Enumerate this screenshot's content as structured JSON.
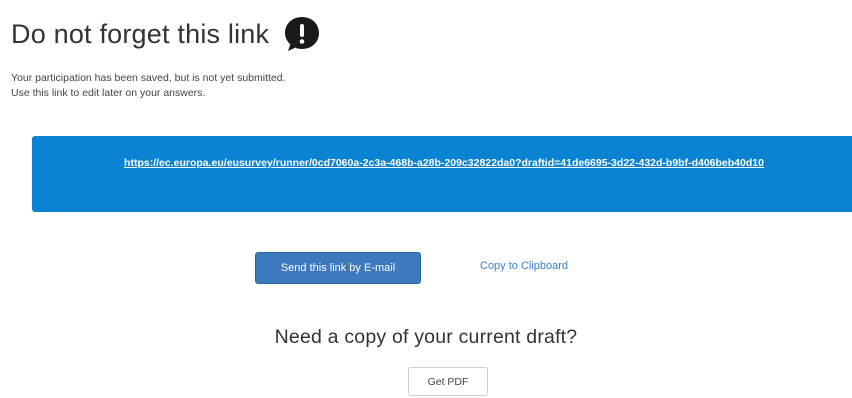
{
  "header": {
    "title": "Do not forget this link",
    "icon": "speech-bubble-exclamation-icon"
  },
  "message": {
    "line1": "Your participation has been saved, but is not yet submitted.",
    "line2": "Use this link to edit later on your answers."
  },
  "link_box": {
    "url": "https://ec.europa.eu/eusurvey/runner/0cd7060a-2c3a-468b-a28b-209c32822da0?draftid=41de6695-3d22-432d-b9bf-d406beb40d10",
    "background": "#0a83d2"
  },
  "actions": {
    "email_label": "Send this link by E-mail",
    "clipboard_label": "Copy to Clipboard"
  },
  "draft": {
    "question": "Need a copy of your current draft?",
    "pdf_label": "Get PDF"
  }
}
